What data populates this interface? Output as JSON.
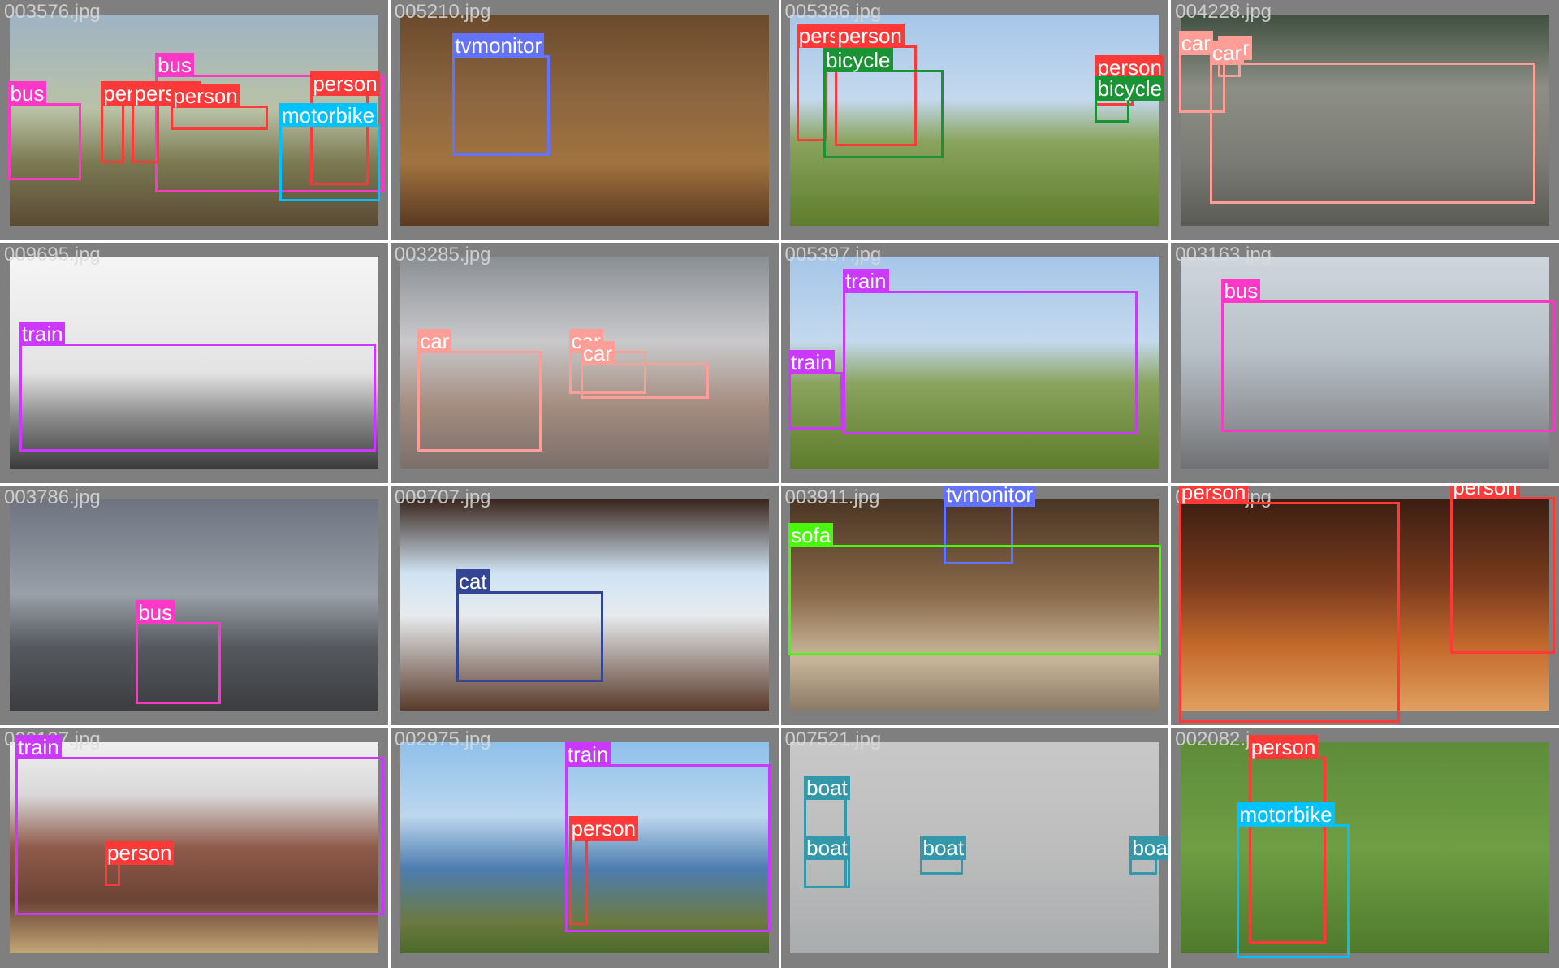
{
  "colors": {
    "person": "#ff3838",
    "bus": "#ff37c7",
    "motorbike": "#00c2ff",
    "tvmonitor": "#6473ff",
    "bicycle": "#1a9334",
    "car": "#ff9d97",
    "train": "#cb38ff",
    "cat": "#344593",
    "sofa": "#48f90a",
    "boat": "#3399aa"
  },
  "tiles": [
    {
      "filename": "003576.jpg",
      "labels": [
        "bus",
        "bus",
        "person",
        "person",
        "person",
        "person",
        "motorbike"
      ]
    },
    {
      "filename": "005210.jpg",
      "labels": [
        "tvmonitor"
      ]
    },
    {
      "filename": "005386.jpg",
      "labels": [
        "person",
        "person",
        "bicycle",
        "person",
        "bicycle"
      ]
    },
    {
      "filename": "004228.jpg",
      "labels": [
        "car",
        "car",
        "car"
      ]
    },
    {
      "filename": "009695.jpg",
      "labels": [
        "train"
      ]
    },
    {
      "filename": "003285.jpg",
      "labels": [
        "car",
        "car",
        "car"
      ]
    },
    {
      "filename": "005397.jpg",
      "labels": [
        "train",
        "train"
      ]
    },
    {
      "filename": "003163.jpg",
      "labels": [
        "bus"
      ]
    },
    {
      "filename": "003786.jpg",
      "labels": [
        "bus"
      ]
    },
    {
      "filename": "009707.jpg",
      "labels": [
        "cat"
      ]
    },
    {
      "filename": "003911.jpg",
      "labels": [
        "tvmonitor",
        "sofa"
      ]
    },
    {
      "filename": "005716.jpg",
      "labels": [
        "person",
        "person"
      ]
    },
    {
      "filename": "008187.jpg",
      "labels": [
        "train",
        "person"
      ]
    },
    {
      "filename": "002975.jpg",
      "labels": [
        "train",
        "person"
      ]
    },
    {
      "filename": "007521.jpg",
      "labels": [
        "boat",
        "boat",
        "boat",
        "boat"
      ]
    },
    {
      "filename": "002082.jpg",
      "labels": [
        "person",
        "motorbike"
      ]
    }
  ]
}
